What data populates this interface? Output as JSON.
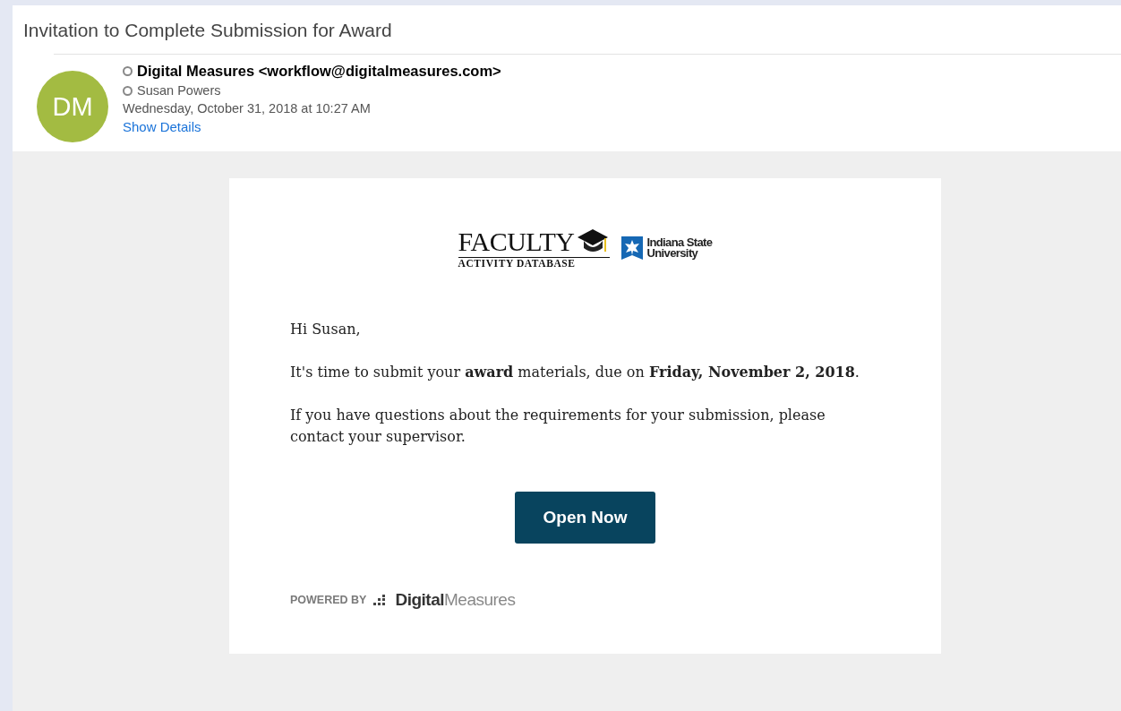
{
  "subject": "Invitation to Complete Submission for Award",
  "sender": {
    "initials": "DM",
    "from": "Digital Measures <workflow@digitalmeasures.com>",
    "to": "Susan Powers",
    "date": "Wednesday, October 31, 2018 at 10:27 AM",
    "details_link": "Show Details"
  },
  "logos": {
    "faculty": "FACULTY",
    "faculty_sub": "ACTIVITY DATABASE",
    "university_line1": "Indiana State",
    "university_line2": "University"
  },
  "body": [
    "Hi Susan,",
    "It's time to submit your **award** materials, due on **Friday, November 2, 2018**.",
    "If you have questions about the requirements for your submission, please contact your supervisor."
  ],
  "button": "Open Now",
  "footer": {
    "powered_by": "POWERED BY",
    "brand": "**Digital**Measures"
  }
}
